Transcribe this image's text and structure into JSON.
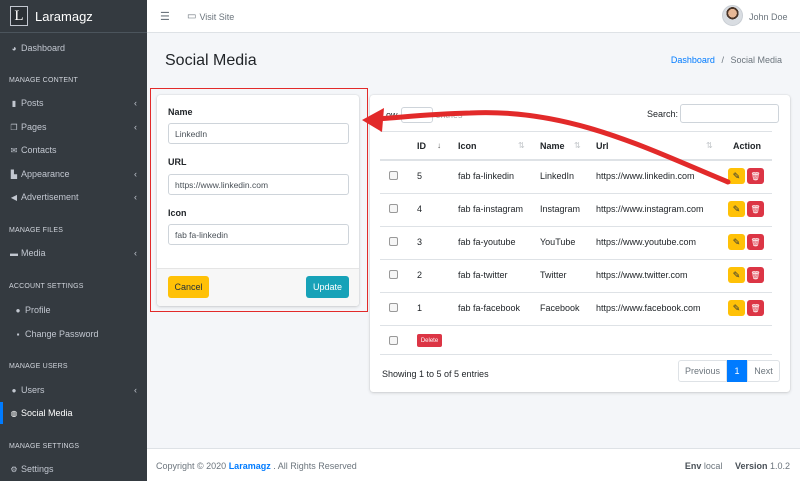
{
  "brand": {
    "logo_letter": "L",
    "name": "Laramagz"
  },
  "topbar": {
    "visit_site": "Visit Site",
    "user_name": "John Doe"
  },
  "sidebar": {
    "dashboard": "Dashboard",
    "manage_content": "MANAGE CONTENT",
    "posts": "Posts",
    "pages": "Pages",
    "contacts": "Contacts",
    "appearance": "Appearance",
    "advertisement": "Advertisement",
    "manage_files": "MANAGE FILES",
    "media": "Media",
    "account_settings": "ACCOUNT SETTINGS",
    "profile": "Profile",
    "change_password": "Change Password",
    "manage_users": "MANAGE USERS",
    "users": "Users",
    "social_media": "Social Media",
    "manage_settings": "MANAGE SETTINGS",
    "settings": "Settings"
  },
  "page": {
    "title": "Social Media",
    "breadcrumb_home": "Dashboard",
    "breadcrumb_sep": "/",
    "breadcrumb_current": "Social Media"
  },
  "form": {
    "name_label": "Name",
    "name_value": "LinkedIn",
    "url_label": "URL",
    "url_value": "https://www.linkedin.com",
    "icon_label": "Icon",
    "icon_value": "fab fa-linkedin",
    "cancel": "Cancel",
    "update": "Update"
  },
  "table": {
    "show_prefix": "ow",
    "show_suffix": "entries",
    "search_label": "Search:",
    "headers": {
      "id": "ID",
      "icon": "Icon",
      "name": "Name",
      "url": "Url",
      "action": "Action"
    },
    "rows": [
      {
        "id": "5",
        "icon": "fab fa-linkedin",
        "name": "LinkedIn",
        "url": "https://www.linkedin.com"
      },
      {
        "id": "4",
        "icon": "fab fa-instagram",
        "name": "Instagram",
        "url": "https://www.instagram.com"
      },
      {
        "id": "3",
        "icon": "fab fa-youtube",
        "name": "YouTube",
        "url": "https://www.youtube.com"
      },
      {
        "id": "2",
        "icon": "fab fa-twitter",
        "name": "Twitter",
        "url": "https://www.twitter.com"
      },
      {
        "id": "1",
        "icon": "fab fa-facebook",
        "name": "Facebook",
        "url": "https://www.facebook.com"
      }
    ],
    "bulk_delete": "Delete",
    "info": "Showing 1 to 5 of 5 entries",
    "pagination": {
      "previous": "Previous",
      "page": "1",
      "next": "Next"
    }
  },
  "footer": {
    "copyright_prefix": "Copyright © 2020",
    "brand": "Laramagz",
    "copyright_suffix": ". All Rights Reserved",
    "env_label": "Env",
    "env_value": "local",
    "version_label": "Version",
    "version_value": "1.0.2"
  },
  "colors": {
    "sidebar": "#343a40",
    "primary": "#007bff",
    "warning": "#ffc107",
    "danger": "#dc3545",
    "info": "#17a2b8",
    "annotation": "#e22a2a"
  }
}
